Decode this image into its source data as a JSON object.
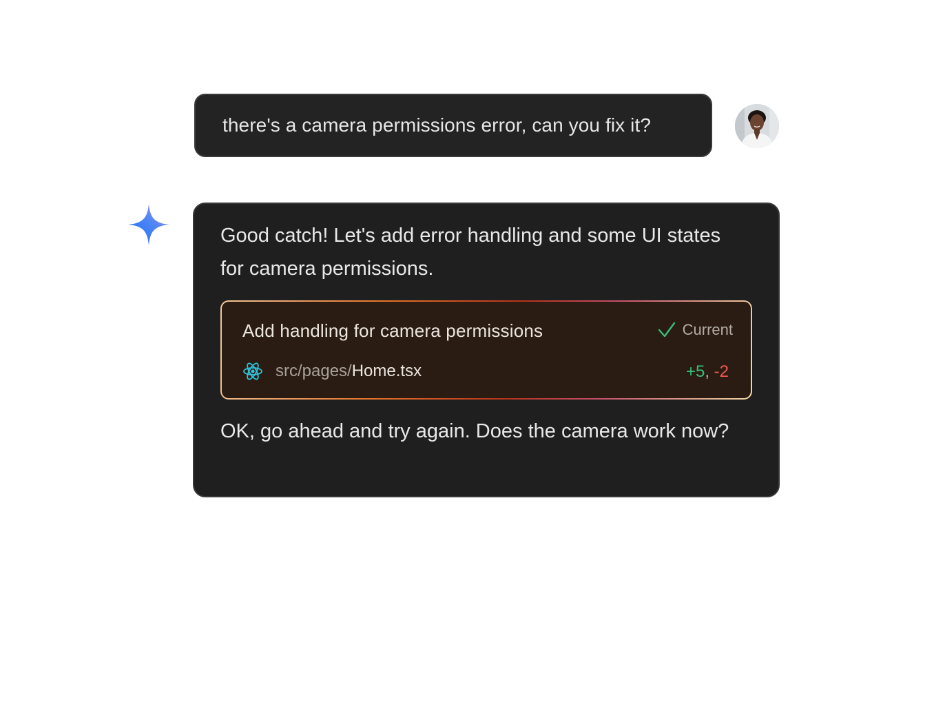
{
  "user_message": {
    "text": "there's a camera permissions error, can you fix it?",
    "avatar_icon": "user-avatar"
  },
  "assistant": {
    "icon": "sparkle-icon",
    "intro": "Good catch! Let's add error handling and some UI states for camera permissions.",
    "change_card": {
      "title": "Add handling for camera permissions",
      "status_icon": "check-icon",
      "status_label": "Current",
      "file_icon": "react-icon",
      "file_dir": "src/pages/",
      "file_name": "Home.tsx",
      "additions": "+5",
      "separator": ",",
      "deletions": "-2"
    },
    "followup": "OK, go ahead and try again. Does the camera work now?"
  },
  "colors": {
    "bubble_bg": "#1f1f1f",
    "card_bg": "#2a1c12",
    "additions": "#35c07a",
    "deletions": "#ef5a50",
    "check": "#35c07a",
    "react": "#2ec4e0"
  }
}
